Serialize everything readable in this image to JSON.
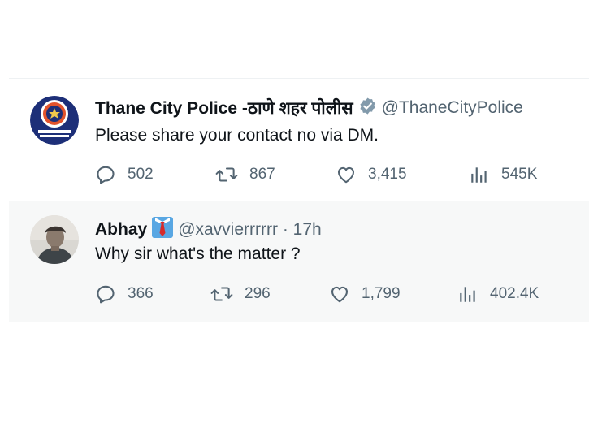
{
  "tweets": [
    {
      "display_name": "Thane City Police -ठाणे शहर पोलीस",
      "handle": "@ThaneCityPolice",
      "text": "Please share your contact no via DM.",
      "replies": "502",
      "retweets": "867",
      "likes": "3,415",
      "views": "545K",
      "verified": true,
      "avatar_icon": "police-badge-logo"
    },
    {
      "display_name": "Abhay",
      "handle": "@xavvierrrrrr · 17h",
      "text": "Why sir what's the matter ?",
      "replies": "366",
      "retweets": "296",
      "likes": "1,799",
      "views": "402.4K",
      "badge_icon": "necktie-emoji",
      "avatar_icon": "user-photo"
    }
  ],
  "colors": {
    "text": "#0f1419",
    "secondary": "#536471",
    "verified_badge": "#829aab",
    "thread_line": "#cfd9de",
    "highlight_bg": "#f7f8f8"
  }
}
